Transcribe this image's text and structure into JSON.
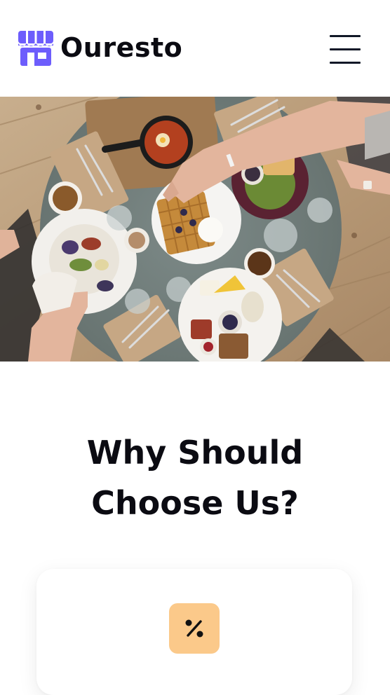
{
  "header": {
    "brand_name": "Ouresto",
    "brand_icon": "storefront-icon",
    "menu_icon": "hamburger-menu-icon"
  },
  "hero": {
    "image": "overhead-dining-table-photo"
  },
  "section": {
    "title_line1": "Why Should",
    "title_line2": "Choose Us?"
  },
  "feature_card": {
    "icon": "percent-icon"
  },
  "colors": {
    "brand_purple": "#6d5dfc",
    "text_dark": "#0b0b12",
    "icon_bg_orange": "#fbc98a",
    "background": "#ffffff"
  }
}
